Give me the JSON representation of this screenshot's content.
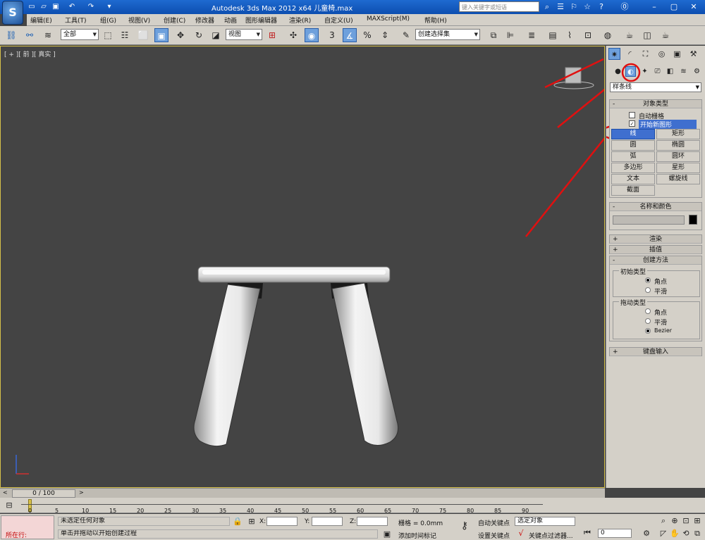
{
  "titlebar": {
    "title": "Autodesk 3ds Max  2012 x64    儿童椅.max",
    "search_placeholder": "键入关键字或短语",
    "logo_letter": "S"
  },
  "menu": [
    "编辑(E)",
    "工具(T)",
    "组(G)",
    "视图(V)",
    "创建(C)",
    "修改器",
    "动画",
    "图形编辑器",
    "渲染(R)",
    "自定义(U)",
    "MAXScript(M)",
    "帮助(H)"
  ],
  "toolbar": {
    "selection_filter": "全部",
    "reference_coord": "视图",
    "named_selection": "创建选择集"
  },
  "viewport": {
    "label": "[ + ][ 前 ][ 真实 ]"
  },
  "command_panel": {
    "category_dropdown": "样条线",
    "object_type": {
      "title": "对象类型",
      "autogrid_label": "自动栅格",
      "start_new_shape_label": "开始新图形",
      "buttons": [
        "线",
        "矩形",
        "圆",
        "椭圆",
        "弧",
        "圆环",
        "多边形",
        "星形",
        "文本",
        "螺旋线",
        "截面"
      ],
      "selected": "线"
    },
    "name_color": {
      "title": "名称和颜色",
      "name_value": ""
    },
    "rollouts_collapsed": [
      "渲染",
      "插值"
    ],
    "creation_method": {
      "title": "创建方法",
      "initial_type_label": "初始类型",
      "initial_options": [
        "角点",
        "平滑"
      ],
      "initial_selected": "角点",
      "drag_type_label": "拖动类型",
      "drag_options": [
        "角点",
        "平滑",
        "Bezier"
      ],
      "drag_selected": "Bezier"
    },
    "keyboard_entry": {
      "title": "键盘输入"
    }
  },
  "timeline": {
    "slider_text": "0 / 100",
    "ticks": [
      "0",
      "5",
      "10",
      "15",
      "20",
      "25",
      "30",
      "35",
      "40",
      "45",
      "50",
      "55",
      "60",
      "65",
      "70",
      "75",
      "80",
      "85",
      "90"
    ]
  },
  "statusbar": {
    "maxscript_label": "所在行:",
    "selection_status": "未选定任何对象",
    "prompt": "单击并拖动以开始创建过程",
    "x_label": "X:",
    "y_label": "Y:",
    "z_label": "Z:",
    "grid": "栅格 = 0.0mm",
    "add_time_tag": "添加时间标记",
    "auto_key": "自动关键点",
    "set_key": "设置关键点",
    "selected_dropdown": "选定对象",
    "key_filters": "关键点过滤器...",
    "frame_value": "0"
  }
}
